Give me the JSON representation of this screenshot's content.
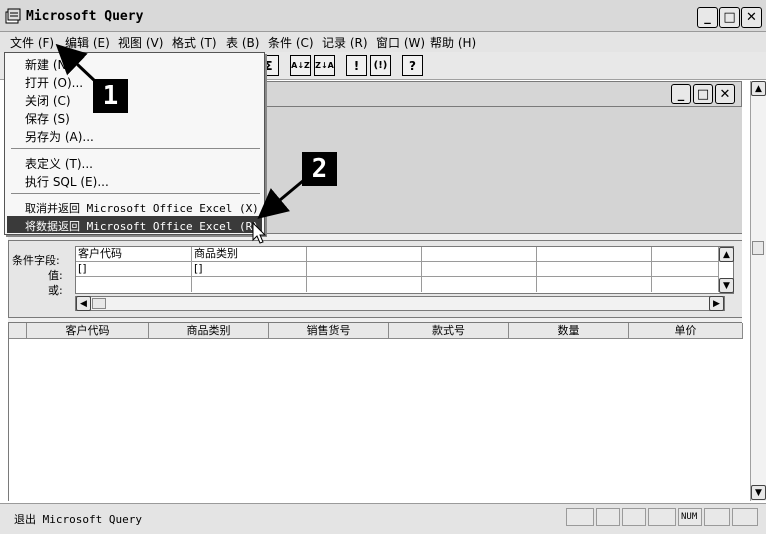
{
  "window": {
    "title": "Microsoft Query",
    "min_glyph": "_",
    "max_glyph": "□",
    "close_glyph": "✕"
  },
  "menubar": {
    "items": [
      {
        "label": "文件 (F)"
      },
      {
        "label": "编辑 (E)"
      },
      {
        "label": "视图 (V)"
      },
      {
        "label": "格式 (T)"
      },
      {
        "label": "表 (B)"
      },
      {
        "label": "条件 (C)"
      },
      {
        "label": "记录 (R)"
      },
      {
        "label": "窗口 (W)"
      },
      {
        "label": "帮助 (H)"
      }
    ]
  },
  "toolbar": {
    "sum_glyph": "Σ",
    "sort_asc_glyph": "A↓Z",
    "sort_desc_glyph": "Z↓A",
    "query_now_glyph": "!",
    "auto_query_glyph": "(!)",
    "help_glyph": "?"
  },
  "file_menu": {
    "items": [
      {
        "label": "新建 (N)"
      },
      {
        "label": "打开 (O)..."
      },
      {
        "label": "关闭 (C)"
      },
      {
        "label": "保存 (S)"
      },
      {
        "label": "另存为 (A)..."
      },
      {
        "label": "表定义 (T)..."
      },
      {
        "label": "执行 SQL (E)..."
      },
      {
        "label": "取消并返回 Microsoft Office Excel (X)"
      },
      {
        "label": "将数据返回 Microsoft Office Excel (R)"
      }
    ]
  },
  "callouts": {
    "one": "1",
    "two": "2"
  },
  "criteria": {
    "row_labels": [
      "条件字段:",
      "值:",
      "或:"
    ],
    "fields": [
      "客户代码",
      "商品类别",
      "",
      "",
      "",
      ""
    ],
    "values": [
      "[]",
      "[]",
      "",
      "",
      "",
      ""
    ]
  },
  "data_table": {
    "columns": [
      "客户代码",
      "商品类别",
      "销售货号",
      "款式号",
      "数量",
      "单价"
    ]
  },
  "statusbar": {
    "text": "退出 Microsoft Query",
    "num_indicator": "NUM"
  },
  "colors": {
    "menu_highlight": "#3a3a3a",
    "callout_bg": "#000000",
    "arrow": "#000000"
  }
}
